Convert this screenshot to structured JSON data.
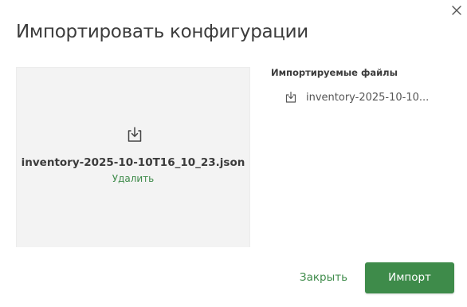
{
  "dialog": {
    "title": "Импортировать конфигурации"
  },
  "dropzone": {
    "icon": "download-icon",
    "filename": "inventory-2025-10-10T16_10_23.json",
    "remove_label": "Удалить"
  },
  "files": {
    "heading": "Импортируемые файлы",
    "items": [
      {
        "icon": "download-icon",
        "name": "inventory-2025-10-10..."
      }
    ]
  },
  "footer": {
    "close_label": "Закрыть",
    "import_label": "Импорт"
  },
  "colors": {
    "accent": "#3e8b4a",
    "text": "#3c3c3c",
    "dropzone_bg": "#f3f3f3"
  }
}
